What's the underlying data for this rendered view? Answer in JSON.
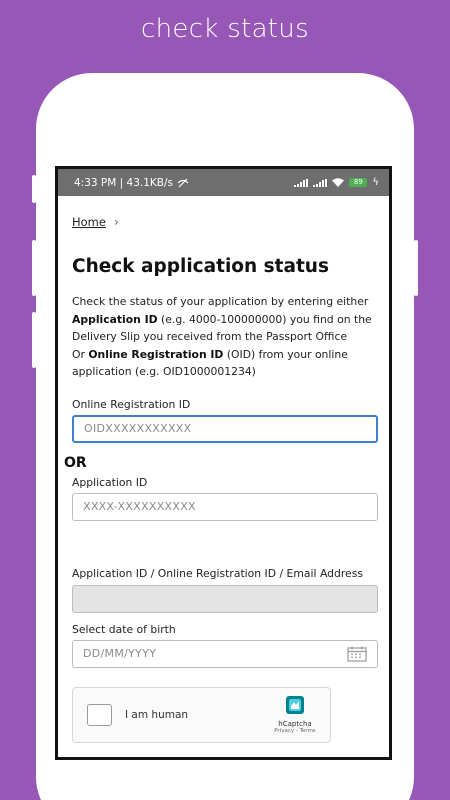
{
  "banner": {
    "title": "check status"
  },
  "statusbar": {
    "time_speed": "4:33 PM | 43.1KB/s",
    "battery": "89"
  },
  "breadcrumb": {
    "home": "Home",
    "chevron": "›"
  },
  "page": {
    "title": "Check application status",
    "intro_line1": "Check the status of your application by entering either",
    "intro_app_id_bold": "Application ID",
    "intro_app_id_rest": " (e.g. 4000-100000000) you find on the Delivery Slip you received from the Passport Office",
    "intro_or": "Or ",
    "intro_oid_bold": "Online Registration ID",
    "intro_oid_rest": " (OID) from your online application (e.g. OID1000001234)"
  },
  "form": {
    "oid_label": "Online Registration ID",
    "oid_placeholder": "OIDXXXXXXXXXXX",
    "or_text": "OR",
    "app_id_label": "Application ID",
    "app_id_placeholder": "XXXX-XXXXXXXXXX",
    "combined_label": "Application ID / Online Registration ID / Email Address",
    "dob_label": "Select date of birth",
    "dob_placeholder": "DD/MM/YYYY"
  },
  "captcha": {
    "label": "I am human",
    "brand": "hCaptcha",
    "links": "Privacy - Terms"
  },
  "colors": {
    "background": "#9657b7",
    "focus_border": "#3f7fcf",
    "statusbar": "#6e6e6e"
  }
}
